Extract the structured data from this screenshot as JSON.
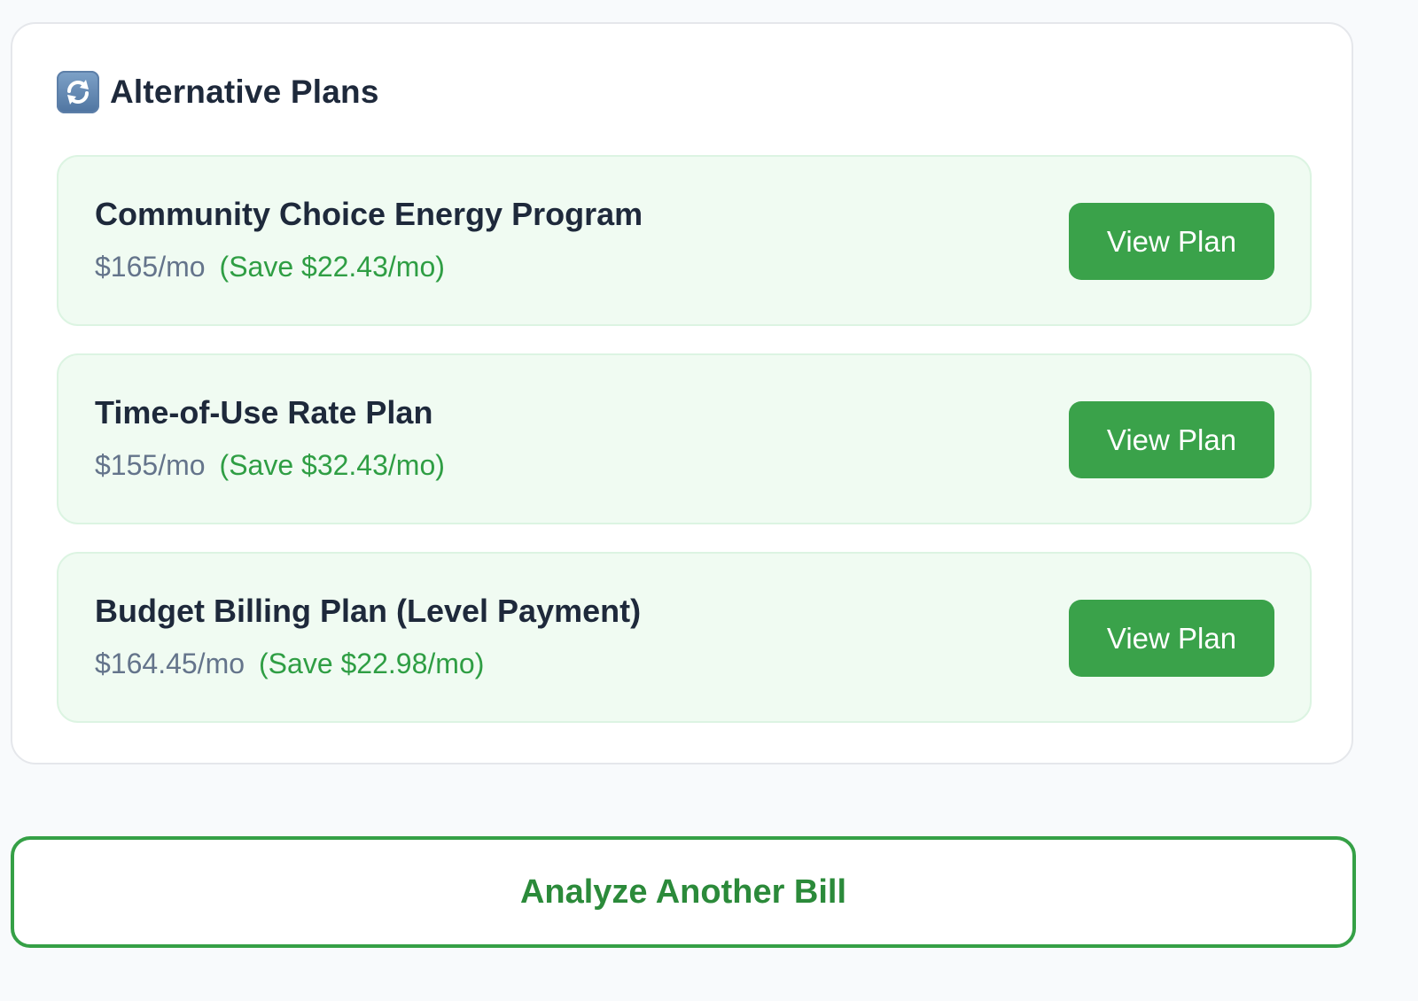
{
  "section": {
    "title": "Alternative Plans",
    "icon": "refresh-arrows-icon"
  },
  "plans": [
    {
      "name": "Community Choice Energy Program",
      "price": "$165/mo",
      "savings": "(Save $22.43/mo)",
      "button_label": "View Plan"
    },
    {
      "name": "Time-of-Use Rate Plan",
      "price": "$155/mo",
      "savings": "(Save $32.43/mo)",
      "button_label": "View Plan"
    },
    {
      "name": "Budget Billing Plan (Level Payment)",
      "price": "$164.45/mo",
      "savings": "(Save $22.98/mo)",
      "button_label": "View Plan"
    }
  ],
  "actions": {
    "analyze_label": "Analyze Another Bill"
  },
  "colors": {
    "accent_green": "#3aa24a",
    "savings_green": "#2f9e44",
    "plan_background": "#f0fbf2",
    "page_background": "#f8fafc",
    "card_background": "#ffffff"
  }
}
